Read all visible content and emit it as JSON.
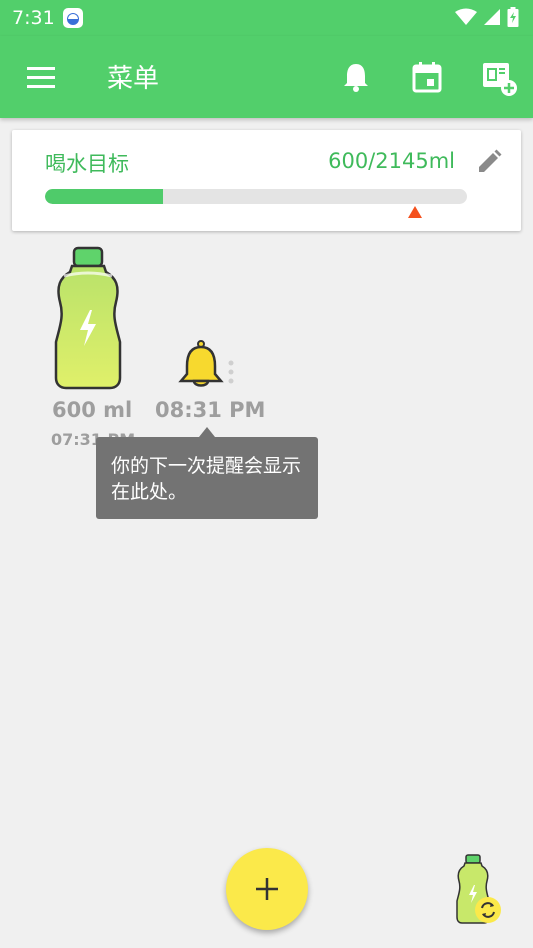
{
  "status_bar": {
    "time": "7:31",
    "icons": [
      "app-notification-icon",
      "wifi-icon",
      "signal-icon",
      "battery-charging-icon"
    ]
  },
  "app_bar": {
    "title": "菜单",
    "actions": [
      "menu-icon",
      "bell-icon",
      "calendar-icon",
      "add-widget-icon"
    ]
  },
  "goal_card": {
    "label": "喝水目标",
    "value": "600/2145ml",
    "progress_fraction": 0.28,
    "edit_icon": "pencil-icon"
  },
  "entry": {
    "amount": "600 ml",
    "time": "07:31 PM",
    "icon": "water-bottle-icon"
  },
  "next_reminder": {
    "time": "08:31 PM",
    "icon": "bell-icon",
    "tooltip": "你的下一次提醒会显示在此处。"
  },
  "fab": {
    "icon": "plus-icon"
  },
  "colors": {
    "primary": "#52cf6b",
    "accent": "#fbe94a",
    "goal_marker": "#f4511e",
    "text_muted": "#9e9e9e",
    "tooltip_bg": "#737373"
  }
}
